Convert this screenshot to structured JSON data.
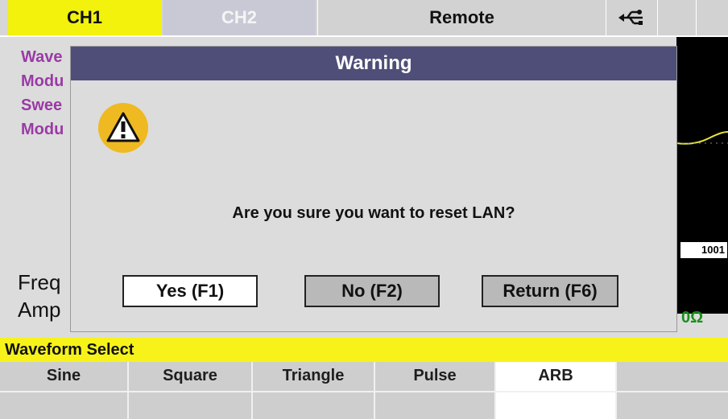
{
  "topbar": {
    "ch1": "CH1",
    "ch2": "CH2",
    "remote": "Remote",
    "usb_icon": "usb-icon"
  },
  "main": {
    "menu": [
      "Wave",
      "Modu",
      "Swee",
      "Modu"
    ],
    "freq_label": "Freq",
    "amp_label": "Amp",
    "wave_label": "1001",
    "impedance": "0Ω"
  },
  "dialog": {
    "title": "Warning",
    "icon": "warning-icon",
    "message": "Are you sure you want to reset LAN?",
    "buttons": {
      "yes": "Yes (F1)",
      "no": "No (F2)",
      "return": "Return (F6)"
    }
  },
  "status_bar": "Waveform Select",
  "softkeys": [
    "Sine",
    "Square",
    "Triangle",
    "Pulse",
    "ARB",
    ""
  ],
  "colors": {
    "ch1_bg": "#f2f20c",
    "dialog_title_bg": "#4f4e78",
    "warning_icon": "#efb921",
    "status_bg": "#f7f31a"
  }
}
